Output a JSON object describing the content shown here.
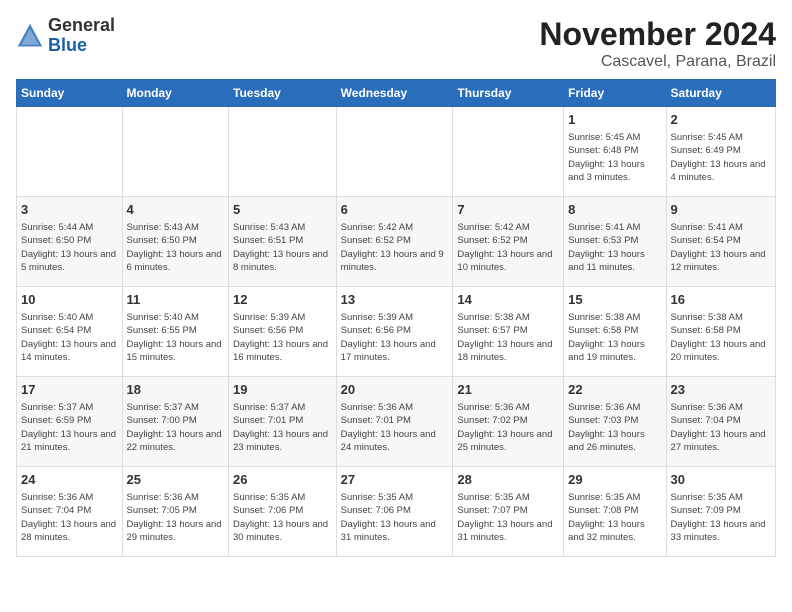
{
  "header": {
    "logo_general": "General",
    "logo_blue": "Blue",
    "month_title": "November 2024",
    "location": "Cascavel, Parana, Brazil"
  },
  "weekdays": [
    "Sunday",
    "Monday",
    "Tuesday",
    "Wednesday",
    "Thursday",
    "Friday",
    "Saturday"
  ],
  "weeks": [
    [
      {
        "day": "",
        "info": ""
      },
      {
        "day": "",
        "info": ""
      },
      {
        "day": "",
        "info": ""
      },
      {
        "day": "",
        "info": ""
      },
      {
        "day": "",
        "info": ""
      },
      {
        "day": "1",
        "info": "Sunrise: 5:45 AM\nSunset: 6:48 PM\nDaylight: 13 hours and 3 minutes."
      },
      {
        "day": "2",
        "info": "Sunrise: 5:45 AM\nSunset: 6:49 PM\nDaylight: 13 hours and 4 minutes."
      }
    ],
    [
      {
        "day": "3",
        "info": "Sunrise: 5:44 AM\nSunset: 6:50 PM\nDaylight: 13 hours and 5 minutes."
      },
      {
        "day": "4",
        "info": "Sunrise: 5:43 AM\nSunset: 6:50 PM\nDaylight: 13 hours and 6 minutes."
      },
      {
        "day": "5",
        "info": "Sunrise: 5:43 AM\nSunset: 6:51 PM\nDaylight: 13 hours and 8 minutes."
      },
      {
        "day": "6",
        "info": "Sunrise: 5:42 AM\nSunset: 6:52 PM\nDaylight: 13 hours and 9 minutes."
      },
      {
        "day": "7",
        "info": "Sunrise: 5:42 AM\nSunset: 6:52 PM\nDaylight: 13 hours and 10 minutes."
      },
      {
        "day": "8",
        "info": "Sunrise: 5:41 AM\nSunset: 6:53 PM\nDaylight: 13 hours and 11 minutes."
      },
      {
        "day": "9",
        "info": "Sunrise: 5:41 AM\nSunset: 6:54 PM\nDaylight: 13 hours and 12 minutes."
      }
    ],
    [
      {
        "day": "10",
        "info": "Sunrise: 5:40 AM\nSunset: 6:54 PM\nDaylight: 13 hours and 14 minutes."
      },
      {
        "day": "11",
        "info": "Sunrise: 5:40 AM\nSunset: 6:55 PM\nDaylight: 13 hours and 15 minutes."
      },
      {
        "day": "12",
        "info": "Sunrise: 5:39 AM\nSunset: 6:56 PM\nDaylight: 13 hours and 16 minutes."
      },
      {
        "day": "13",
        "info": "Sunrise: 5:39 AM\nSunset: 6:56 PM\nDaylight: 13 hours and 17 minutes."
      },
      {
        "day": "14",
        "info": "Sunrise: 5:38 AM\nSunset: 6:57 PM\nDaylight: 13 hours and 18 minutes."
      },
      {
        "day": "15",
        "info": "Sunrise: 5:38 AM\nSunset: 6:58 PM\nDaylight: 13 hours and 19 minutes."
      },
      {
        "day": "16",
        "info": "Sunrise: 5:38 AM\nSunset: 6:58 PM\nDaylight: 13 hours and 20 minutes."
      }
    ],
    [
      {
        "day": "17",
        "info": "Sunrise: 5:37 AM\nSunset: 6:59 PM\nDaylight: 13 hours and 21 minutes."
      },
      {
        "day": "18",
        "info": "Sunrise: 5:37 AM\nSunset: 7:00 PM\nDaylight: 13 hours and 22 minutes."
      },
      {
        "day": "19",
        "info": "Sunrise: 5:37 AM\nSunset: 7:01 PM\nDaylight: 13 hours and 23 minutes."
      },
      {
        "day": "20",
        "info": "Sunrise: 5:36 AM\nSunset: 7:01 PM\nDaylight: 13 hours and 24 minutes."
      },
      {
        "day": "21",
        "info": "Sunrise: 5:36 AM\nSunset: 7:02 PM\nDaylight: 13 hours and 25 minutes."
      },
      {
        "day": "22",
        "info": "Sunrise: 5:36 AM\nSunset: 7:03 PM\nDaylight: 13 hours and 26 minutes."
      },
      {
        "day": "23",
        "info": "Sunrise: 5:36 AM\nSunset: 7:04 PM\nDaylight: 13 hours and 27 minutes."
      }
    ],
    [
      {
        "day": "24",
        "info": "Sunrise: 5:36 AM\nSunset: 7:04 PM\nDaylight: 13 hours and 28 minutes."
      },
      {
        "day": "25",
        "info": "Sunrise: 5:36 AM\nSunset: 7:05 PM\nDaylight: 13 hours and 29 minutes."
      },
      {
        "day": "26",
        "info": "Sunrise: 5:35 AM\nSunset: 7:06 PM\nDaylight: 13 hours and 30 minutes."
      },
      {
        "day": "27",
        "info": "Sunrise: 5:35 AM\nSunset: 7:06 PM\nDaylight: 13 hours and 31 minutes."
      },
      {
        "day": "28",
        "info": "Sunrise: 5:35 AM\nSunset: 7:07 PM\nDaylight: 13 hours and 31 minutes."
      },
      {
        "day": "29",
        "info": "Sunrise: 5:35 AM\nSunset: 7:08 PM\nDaylight: 13 hours and 32 minutes."
      },
      {
        "day": "30",
        "info": "Sunrise: 5:35 AM\nSunset: 7:09 PM\nDaylight: 13 hours and 33 minutes."
      }
    ]
  ]
}
